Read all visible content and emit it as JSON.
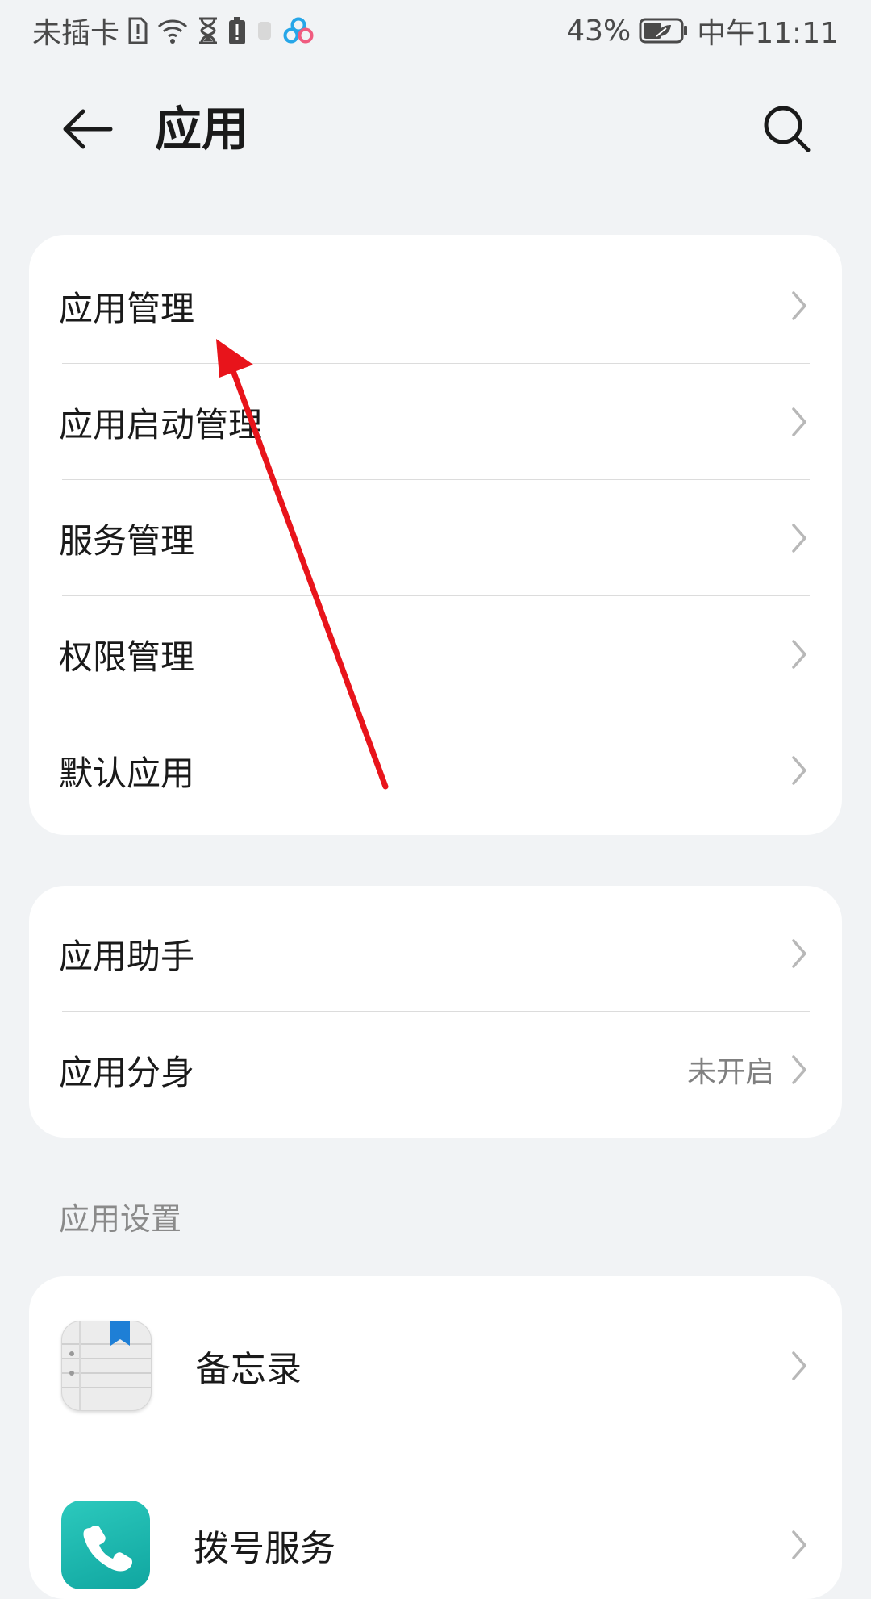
{
  "status_bar": {
    "carrier": "未插卡",
    "battery_percent": "43%",
    "time": "中午11:11"
  },
  "header": {
    "title": "应用"
  },
  "card1": {
    "items": [
      {
        "label": "应用管理"
      },
      {
        "label": "应用启动管理"
      },
      {
        "label": "服务管理"
      },
      {
        "label": "权限管理"
      },
      {
        "label": "默认应用"
      }
    ]
  },
  "card2": {
    "items": [
      {
        "label": "应用助手"
      },
      {
        "label": "应用分身",
        "value": "未开启"
      }
    ]
  },
  "app_settings": {
    "section_label": "应用设置",
    "items": [
      {
        "label": "备忘录",
        "icon": "notes-app-icon"
      },
      {
        "label": "拨号服务",
        "icon": "dialer-app-icon"
      }
    ]
  },
  "colors": {
    "background": "#f1f3f5",
    "card": "#ffffff",
    "annotation_arrow": "#e8141b",
    "notes_bookmark": "#1e7fd6",
    "dialer_teal": "#19b8b0"
  },
  "icons": {
    "back": "arrow-left-icon",
    "search": "search-icon",
    "chevron": "chevron-right-icon"
  }
}
